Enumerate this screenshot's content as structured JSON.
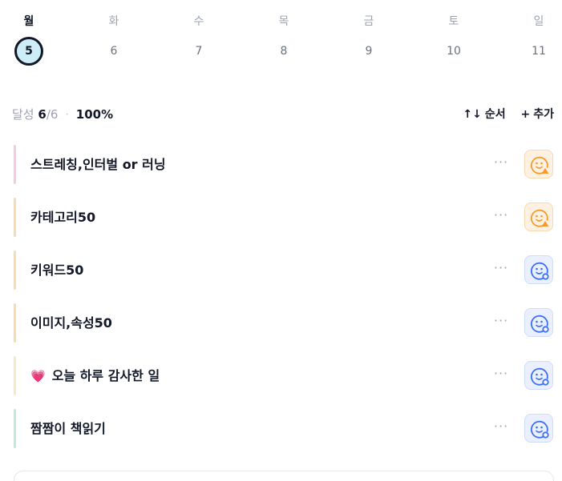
{
  "week": {
    "days": [
      {
        "name": "월",
        "date": "5",
        "selected": true
      },
      {
        "name": "화",
        "date": "6",
        "selected": false
      },
      {
        "name": "수",
        "date": "7",
        "selected": false
      },
      {
        "name": "목",
        "date": "8",
        "selected": false
      },
      {
        "name": "금",
        "date": "9",
        "selected": false
      },
      {
        "name": "토",
        "date": "10",
        "selected": false
      },
      {
        "name": "일",
        "date": "11",
        "selected": false
      }
    ]
  },
  "summary": {
    "label": "달성",
    "done": "6",
    "total": "/6",
    "separator": "·",
    "percent": "100%"
  },
  "actions": {
    "sort_label": "순서",
    "sort_icon": "↑↓",
    "add_label": "추가",
    "add_icon": "+"
  },
  "tasks": [
    {
      "title": "스트레칭,인터벌 or 러닝",
      "bar_color": "#f9c9e2",
      "status": "warning",
      "more": "···"
    },
    {
      "title": "카테고리50",
      "bar_color": "#f8dcb0",
      "status": "warning",
      "more": "···"
    },
    {
      "title": "키워드50",
      "bar_color": "#f8dcb0",
      "status": "done",
      "more": "···"
    },
    {
      "title": "이미지,속성50",
      "bar_color": "#f8dcb0",
      "status": "done",
      "more": "···"
    },
    {
      "title": "오늘 하루 감사한 일",
      "emoji": "💗",
      "bar_color": "#fde6c6",
      "status": "done",
      "more": "···"
    },
    {
      "title": "짬짬이 책읽기",
      "bar_color": "#bfe9d8",
      "status": "done",
      "more": "···"
    }
  ],
  "status_styles": {
    "warning": {
      "bg": "#fff1e2",
      "border": "#fbd9b3",
      "stroke": "#f59a2b",
      "icon": "smiley-warning-icon"
    },
    "done": {
      "bg": "#eaf0ff",
      "border": "#cfdcfb",
      "stroke": "#3b6ff5",
      "icon": "smiley-check-icon"
    }
  }
}
